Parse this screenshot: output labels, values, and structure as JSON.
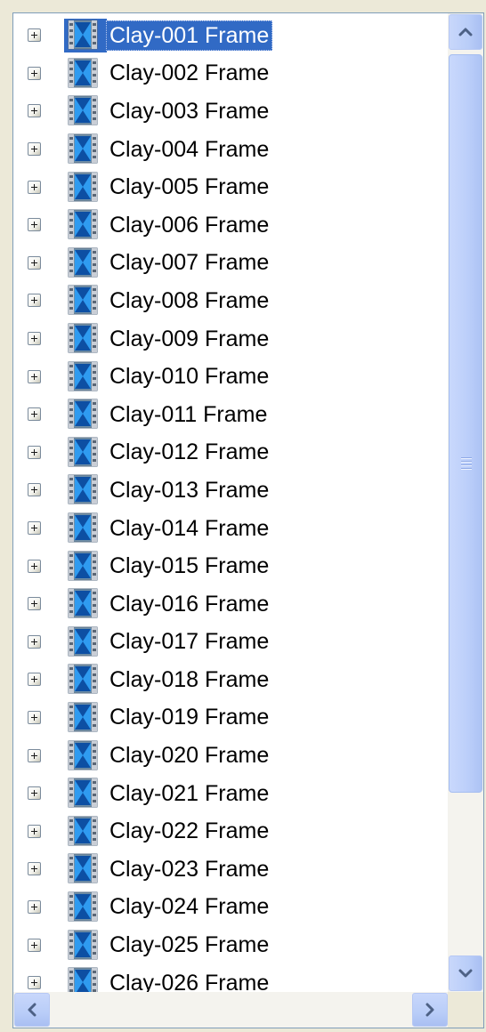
{
  "tree": {
    "selected_index": 0,
    "items": [
      {
        "label": "Clay-001 Frame",
        "expander": "plus-icon",
        "icon": "film-clip-icon"
      },
      {
        "label": "Clay-002 Frame",
        "expander": "plus-icon",
        "icon": "film-clip-icon"
      },
      {
        "label": "Clay-003 Frame",
        "expander": "plus-icon",
        "icon": "film-clip-icon"
      },
      {
        "label": "Clay-004 Frame",
        "expander": "plus-icon",
        "icon": "film-clip-icon"
      },
      {
        "label": "Clay-005 Frame",
        "expander": "plus-icon",
        "icon": "film-clip-icon"
      },
      {
        "label": "Clay-006 Frame",
        "expander": "plus-icon",
        "icon": "film-clip-icon"
      },
      {
        "label": "Clay-007 Frame",
        "expander": "plus-icon",
        "icon": "film-clip-icon"
      },
      {
        "label": "Clay-008 Frame",
        "expander": "plus-icon",
        "icon": "film-clip-icon"
      },
      {
        "label": "Clay-009 Frame",
        "expander": "plus-icon",
        "icon": "film-clip-icon"
      },
      {
        "label": "Clay-010 Frame",
        "expander": "plus-icon",
        "icon": "film-clip-icon"
      },
      {
        "label": "Clay-011 Frame",
        "expander": "plus-icon",
        "icon": "film-clip-icon"
      },
      {
        "label": "Clay-012 Frame",
        "expander": "plus-icon",
        "icon": "film-clip-icon"
      },
      {
        "label": "Clay-013 Frame",
        "expander": "plus-icon",
        "icon": "film-clip-icon"
      },
      {
        "label": "Clay-014 Frame",
        "expander": "plus-icon",
        "icon": "film-clip-icon"
      },
      {
        "label": "Clay-015 Frame",
        "expander": "plus-icon",
        "icon": "film-clip-icon"
      },
      {
        "label": "Clay-016 Frame",
        "expander": "plus-icon",
        "icon": "film-clip-icon"
      },
      {
        "label": "Clay-017 Frame",
        "expander": "plus-icon",
        "icon": "film-clip-icon"
      },
      {
        "label": "Clay-018 Frame",
        "expander": "plus-icon",
        "icon": "film-clip-icon"
      },
      {
        "label": "Clay-019 Frame",
        "expander": "plus-icon",
        "icon": "film-clip-icon"
      },
      {
        "label": "Clay-020 Frame",
        "expander": "plus-icon",
        "icon": "film-clip-icon"
      },
      {
        "label": "Clay-021 Frame",
        "expander": "plus-icon",
        "icon": "film-clip-icon"
      },
      {
        "label": "Clay-022 Frame",
        "expander": "plus-icon",
        "icon": "film-clip-icon"
      },
      {
        "label": "Clay-023 Frame",
        "expander": "plus-icon",
        "icon": "film-clip-icon"
      },
      {
        "label": "Clay-024 Frame",
        "expander": "plus-icon",
        "icon": "film-clip-icon"
      },
      {
        "label": "Clay-025 Frame",
        "expander": "plus-icon",
        "icon": "film-clip-icon"
      },
      {
        "label": "Clay-026 Frame",
        "expander": "plus-icon",
        "icon": "film-clip-icon"
      }
    ]
  },
  "scrollbars": {
    "vertical": {
      "up_icon": "chevron-up-icon",
      "down_icon": "chevron-down-icon",
      "thumb_icon": "grip-icon"
    },
    "horizontal": {
      "left_icon": "chevron-left-icon",
      "right_icon": "chevron-right-icon"
    }
  },
  "colors": {
    "selection": "#316ac5",
    "panel_border": "#7f9db9",
    "scrollbar_face": "#c1d3fb",
    "arrow": "#4d6185",
    "window_bg": "#ece9d8"
  }
}
